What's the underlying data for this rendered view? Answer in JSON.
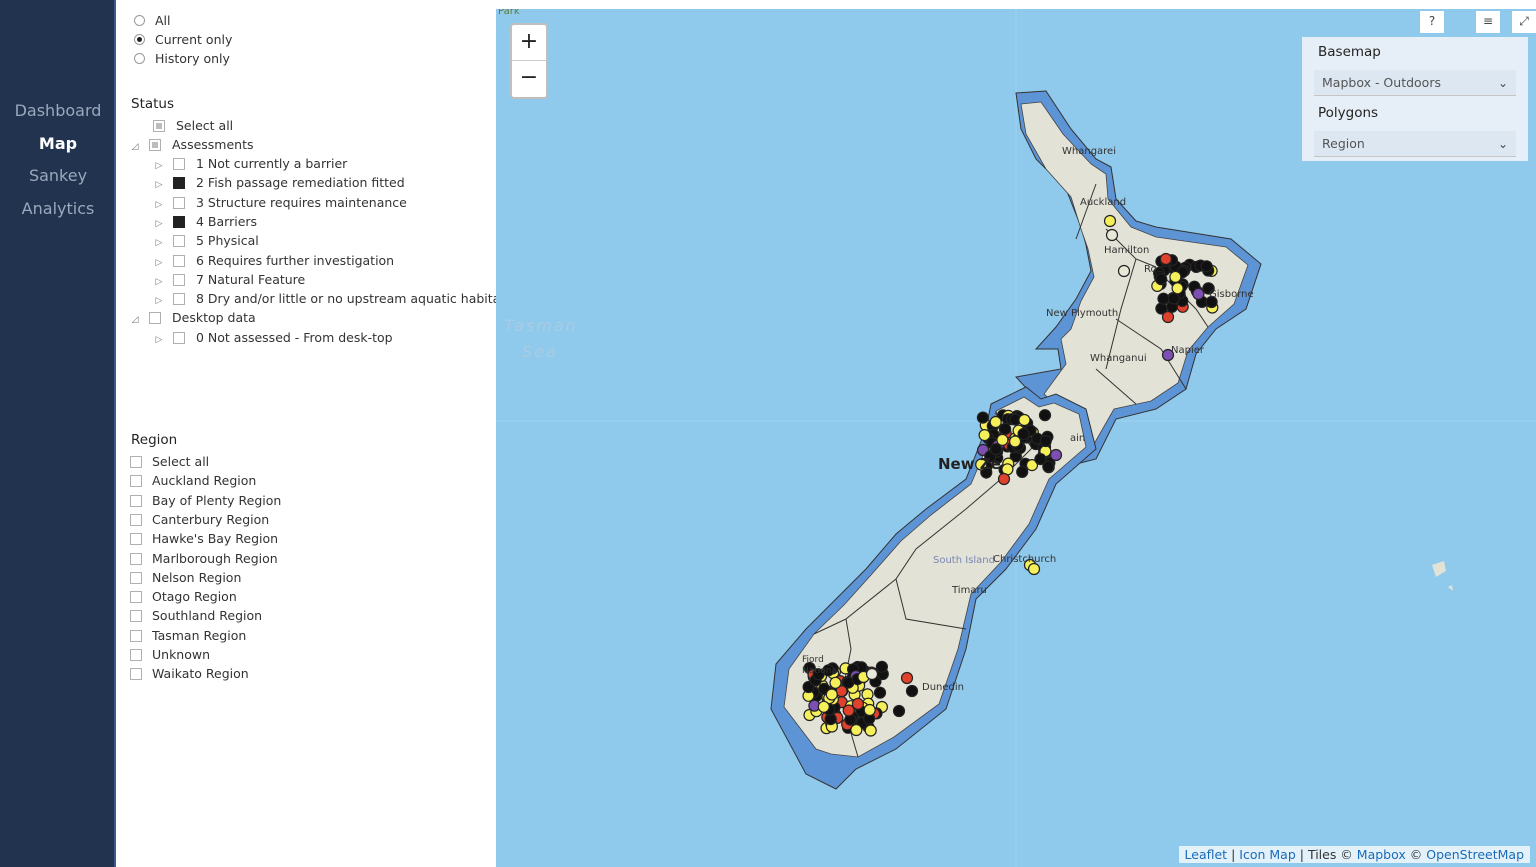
{
  "nav": {
    "items": [
      {
        "label": "Dashboard"
      },
      {
        "label": "Map"
      },
      {
        "label": "Sankey"
      },
      {
        "label": "Analytics"
      }
    ]
  },
  "history_filter": {
    "options": [
      "All",
      "Current only",
      "History only"
    ],
    "selected": "Current only"
  },
  "status": {
    "title": "Status",
    "select_all": "Select all",
    "groups": [
      {
        "label": "Assessments",
        "items": [
          "1 Not currently a barrier",
          "2 Fish passage remediation fitted",
          "3 Structure requires maintenance",
          "4 Barriers",
          "5 Physical",
          "6 Requires further investigation",
          "7 Natural Feature",
          "8 Dry and/or little or no upstream aquatic habitat"
        ],
        "checked": [
          "2 Fish passage remediation fitted",
          "4 Barriers"
        ]
      },
      {
        "label": "Desktop data",
        "items": [
          "0 Not assessed - From desk-top"
        ]
      }
    ]
  },
  "region": {
    "title": "Region",
    "items": [
      "Select all",
      "Auckland Region",
      "Bay of Plenty Region",
      "Canterbury Region",
      "Hawke's Bay Region",
      "Marlborough Region",
      "Nelson Region",
      "Otago Region",
      "Southland Region",
      "Tasman Region",
      "Unknown",
      "Waikato Region"
    ]
  },
  "map": {
    "zoom_in": "+",
    "zoom_out": "−",
    "basemap_label": "Basemap",
    "basemap_value": "Mapbox - Outdoors",
    "polygons_label": "Polygons",
    "polygons_value": "Region",
    "corner_text": "Park",
    "sea_label_1": "Tasman",
    "sea_label_2": "Sea",
    "country_label": "New Ze",
    "place_labels": [
      "Whangarei",
      "Auckland",
      "Hamilton",
      "Ro",
      "Gisborne",
      "New Plymouth",
      "Whanganui",
      "Napier",
      "South Island",
      "Christchurch",
      "Timaru",
      "Dunedin",
      "Fiord National",
      "ain"
    ],
    "attribution": {
      "leaflet": "Leaflet",
      "iconmap": "Icon Map",
      "tiles": "Tiles ©",
      "mapbox": "Mapbox",
      "copy": "©",
      "osm": "OpenStreetMap",
      "sep": "|"
    },
    "colors": {
      "sea": "#8fc9eb",
      "land": "#e3e2d6",
      "buffer": "#5d94d6",
      "black": "#111111",
      "yellow": "#f5f05a",
      "red": "#e0412c",
      "purple": "#7d4fb3",
      "grey": "#e8e8d8"
    }
  }
}
